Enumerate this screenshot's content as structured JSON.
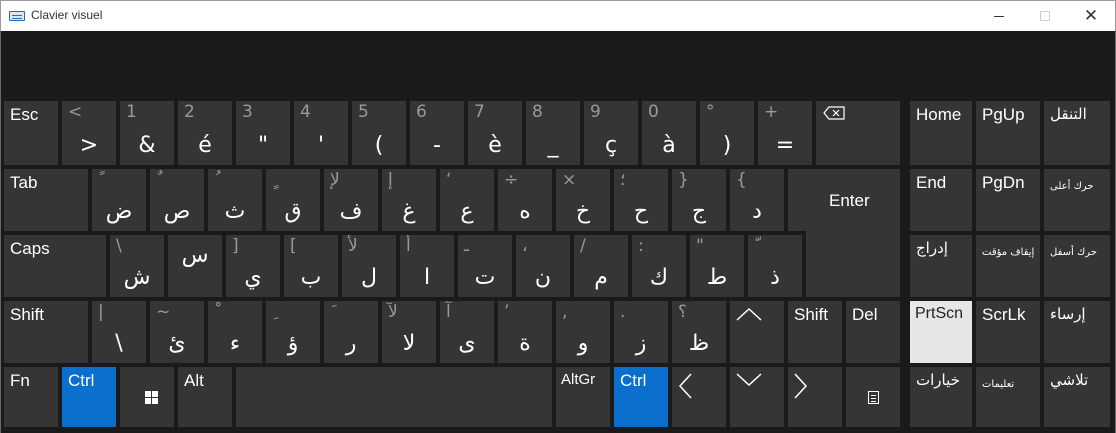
{
  "window": {
    "title": "Clavier visuel",
    "close_label": "✕"
  },
  "rows": [
    [
      {
        "name": "key-esc",
        "label": "Esc"
      },
      {
        "name": "key-1",
        "shift": "<",
        "char": ">"
      },
      {
        "name": "key-2",
        "shift": "1",
        "char": "&"
      },
      {
        "name": "key-3",
        "shift": "2",
        "char": "é"
      },
      {
        "name": "key-4",
        "shift": "3",
        "char": "\""
      },
      {
        "name": "key-5",
        "shift": "4",
        "char": "'"
      },
      {
        "name": "key-6",
        "shift": "5",
        "char": "("
      },
      {
        "name": "key-7",
        "shift": "6",
        "char": "-"
      },
      {
        "name": "key-8",
        "shift": "7",
        "char": "è"
      },
      {
        "name": "key-9",
        "shift": "8",
        "char": "_"
      },
      {
        "name": "key-10",
        "shift": "9",
        "char": "ç"
      },
      {
        "name": "key-11",
        "shift": "0",
        "char": "à"
      },
      {
        "name": "key-12",
        "shift": "°",
        "char": ")"
      },
      {
        "name": "key-13",
        "shift": "+",
        "char": "="
      },
      {
        "name": "key-backspace",
        "icon": "backspace-icon"
      }
    ],
    [
      {
        "name": "key-tab",
        "label": "Tab"
      },
      {
        "name": "key-q",
        "shift": "ً",
        "char": "ض"
      },
      {
        "name": "key-w",
        "shift": "ٌ",
        "char": "ص"
      },
      {
        "name": "key-e",
        "shift": "ُ",
        "char": "ث"
      },
      {
        "name": "key-r",
        "shift": "ٍ",
        "char": "ق"
      },
      {
        "name": "key-t",
        "shift": "لإ",
        "char": "ف"
      },
      {
        "name": "key-y",
        "shift": "إ",
        "char": "غ"
      },
      {
        "name": "key-u",
        "shift": "‘",
        "char": "ع"
      },
      {
        "name": "key-i",
        "shift": "÷",
        "char": "ه"
      },
      {
        "name": "key-o",
        "shift": "×",
        "char": "خ"
      },
      {
        "name": "key-p",
        "shift": "؛",
        "char": "ح"
      },
      {
        "name": "key-bracket-open",
        "shift": "}",
        "char": "ج"
      },
      {
        "name": "key-bracket-close",
        "shift": "{",
        "char": "د"
      },
      {
        "name": "key-enter",
        "label": "Enter"
      }
    ],
    [
      {
        "name": "key-caps",
        "label": "Caps"
      },
      {
        "name": "key-a",
        "shift": "\\",
        "char": "ش"
      },
      {
        "name": "key-s",
        "char": "س"
      },
      {
        "name": "key-d",
        "shift": "]",
        "char": "ي"
      },
      {
        "name": "key-f",
        "shift": "[",
        "char": "ب"
      },
      {
        "name": "key-g",
        "shift": "لأ",
        "char": "ل"
      },
      {
        "name": "key-h",
        "shift": "أ",
        "char": "ا"
      },
      {
        "name": "key-j",
        "shift": "ـ",
        "char": "ت"
      },
      {
        "name": "key-k",
        "shift": "،",
        "char": "ن"
      },
      {
        "name": "key-l",
        "shift": "/",
        "char": "م"
      },
      {
        "name": "key-m",
        "shift": ":",
        "char": "ك"
      },
      {
        "name": "key-quote",
        "shift": "\"",
        "char": "ط"
      },
      {
        "name": "key-backslash",
        "shift": "ّ",
        "char": "ذ"
      }
    ],
    [
      {
        "name": "key-shift-left",
        "label": "Shift"
      },
      {
        "name": "key-angle",
        "shift": "|",
        "char": "\\"
      },
      {
        "name": "key-z",
        "shift": "~",
        "char": "ئ"
      },
      {
        "name": "key-x",
        "shift": "ْ",
        "char": "ء"
      },
      {
        "name": "key-c",
        "shift": "ِ",
        "char": "ؤ"
      },
      {
        "name": "key-v",
        "shift": "َ",
        "char": "ر"
      },
      {
        "name": "key-b",
        "shift": "لآ",
        "char": "لا"
      },
      {
        "name": "key-n",
        "shift": "آ",
        "char": "ى"
      },
      {
        "name": "key-comma",
        "shift": "’",
        "char": "ة"
      },
      {
        "name": "key-semicolon",
        "shift": ",",
        "char": "و"
      },
      {
        "name": "key-colon",
        "shift": ".",
        "char": "ز"
      },
      {
        "name": "key-excl",
        "shift": "؟",
        "char": "ظ"
      },
      {
        "name": "key-up",
        "icon": "up-arrow-icon",
        "glyph": "⌃"
      },
      {
        "name": "key-shift-right",
        "label": "Shift"
      },
      {
        "name": "key-del",
        "label": "Del"
      }
    ],
    [
      {
        "name": "key-fn",
        "label": "Fn"
      },
      {
        "name": "key-ctrl-left",
        "label": "Ctrl"
      },
      {
        "name": "key-windows",
        "icon": "windows-logo-icon"
      },
      {
        "name": "key-alt",
        "label": "Alt"
      },
      {
        "name": "key-space",
        "label": ""
      },
      {
        "name": "key-altgr",
        "label": "AltGr"
      },
      {
        "name": "key-ctrl-right",
        "label": "Ctrl"
      },
      {
        "name": "key-left",
        "icon": "left-arrow-icon",
        "glyph": "〈"
      },
      {
        "name": "key-down",
        "icon": "down-arrow-icon",
        "glyph": "⌄"
      },
      {
        "name": "key-right",
        "icon": "right-arrow-icon",
        "glyph": "〉"
      },
      {
        "name": "key-menu",
        "icon": "context-menu-icon"
      }
    ]
  ],
  "nav": [
    {
      "name": "key-home",
      "label": "Home"
    },
    {
      "name": "key-pgup",
      "label": "PgUp"
    },
    {
      "name": "key-navigate",
      "label": "التنقل"
    },
    {
      "name": "key-end",
      "label": "End"
    },
    {
      "name": "key-pgdn",
      "label": "PgDn"
    },
    {
      "name": "key-move-up",
      "label": "حرك أعلى"
    },
    {
      "name": "key-insert",
      "label": "إدراج"
    },
    {
      "name": "key-pause",
      "label": "إيقاف مؤقت"
    },
    {
      "name": "key-move-down",
      "label": "حرك أسفل"
    },
    {
      "name": "key-prtscn",
      "label": "PrtScn"
    },
    {
      "name": "key-scrlk",
      "label": "ScrLk"
    },
    {
      "name": "key-dock",
      "label": "إرساء"
    },
    {
      "name": "key-options",
      "label": "خيارات"
    },
    {
      "name": "key-help",
      "label": "تعليمات"
    },
    {
      "name": "key-fade",
      "label": "تلاشي"
    }
  ],
  "colors": {
    "key_bg": "#353535",
    "accent": "#0b6fce",
    "pressed": "#e6e6e6",
    "shift_text": "#9a9a9a"
  }
}
